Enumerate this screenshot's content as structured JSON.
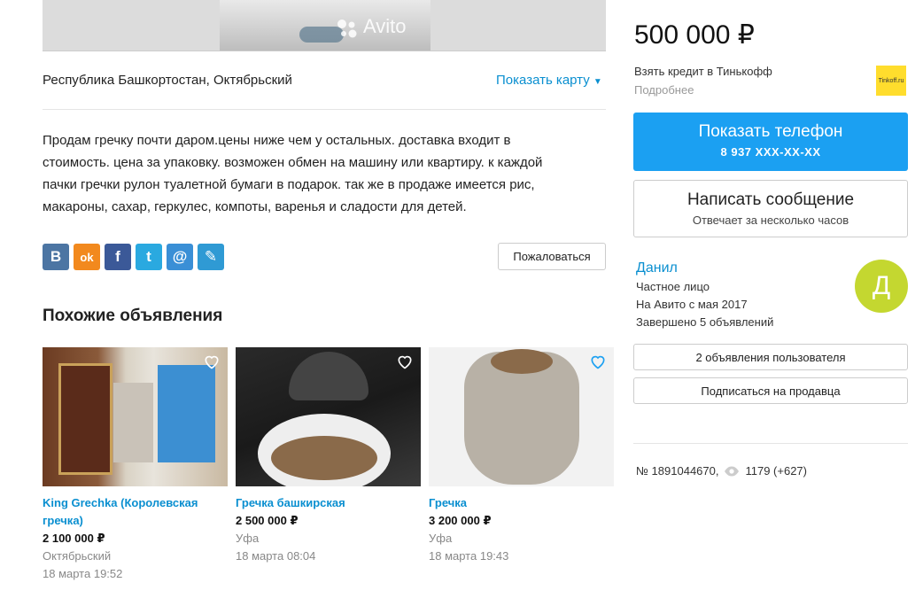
{
  "gallery": {
    "watermark": "Avito"
  },
  "location": {
    "text": "Республика Башкортостан, Октябрьский",
    "map_link": "Показать карту"
  },
  "description": {
    "lines": [
      "Продам гречку почти даром.цены ниже чем у остальных. доставка входит в",
      "стоимость. цена за упаковку. возможен обмен на машину или квартиру. к каждой",
      "пачки гречки рулон туалетной бумаги в подарок. так же в продаже имеется рис,",
      "макароны, сахар, геркулес, компоты, варенья и сладости для детей."
    ]
  },
  "share": {
    "icons": [
      {
        "name": "vk-icon",
        "glyph": "В",
        "color": "#4c75a3"
      },
      {
        "name": "odnoklassniki-icon",
        "glyph": "ok",
        "color": "#f2891e"
      },
      {
        "name": "facebook-icon",
        "glyph": "f",
        "color": "#3b5998"
      },
      {
        "name": "twitter-icon",
        "glyph": "t",
        "color": "#2aa9e0"
      },
      {
        "name": "mailru-icon",
        "glyph": "@",
        "color": "#3a8fd6"
      },
      {
        "name": "livejournal-icon",
        "glyph": "✎",
        "color": "#2f9ad4"
      }
    ],
    "complain_label": "Пожаловаться"
  },
  "similar": {
    "heading": "Похожие объявления",
    "items": [
      {
        "title": "King Grechka (Королевская гречка)",
        "price": "2 100 000 ₽",
        "city": "Октябрьский",
        "date": "18 марта 19:52"
      },
      {
        "title": "Гречка башкирская",
        "price": "2 500 000 ₽",
        "city": "Уфа",
        "date": "18 марта 08:04"
      },
      {
        "title": "Гречка",
        "price": "3 200 000 ₽",
        "city": "Уфа",
        "date": "18 марта 19:43"
      }
    ]
  },
  "sidebar": {
    "price": "500 000 ₽",
    "credit": "Взять кредит в Тинькофф",
    "credit_more": "Подробнее",
    "tinkoff_logo": "Tinkoff.ru",
    "phone_button": {
      "label": "Показать телефон",
      "number": "8 937 XXX-XX-XX"
    },
    "message_button": {
      "label": "Написать сообщение",
      "sub": "Отвечает за несколько часов"
    },
    "seller": {
      "name": "Данил",
      "type": "Частное лицо",
      "since": "На Авито с мая 2017",
      "done": "Завершено 5 объявлений",
      "avatar_letter": "Д"
    },
    "user_ads_button": "2 объявления пользователя",
    "subscribe_button": "Подписаться на продавца",
    "ad_number": "№ 1891044670,",
    "views": "1179 (+627)"
  }
}
